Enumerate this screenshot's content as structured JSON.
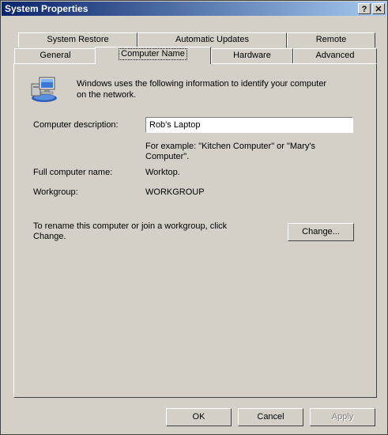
{
  "window": {
    "title": "System Properties",
    "help_label": "?",
    "close_label": "✕"
  },
  "tabs": {
    "row1": [
      "System Restore",
      "Automatic Updates",
      "Remote"
    ],
    "row2": [
      "General",
      "Computer Name",
      "Hardware",
      "Advanced"
    ],
    "active": "Computer Name"
  },
  "content": {
    "intro_text_line1": "Windows uses the following information to identify your computer",
    "intro_text_line2": "on the network.",
    "description_label": "Computer description:",
    "description_value": "Rob's Laptop",
    "example_line1": "For example: \"Kitchen Computer\" or \"Mary's",
    "example_line2": "Computer\".",
    "full_name_label": "Full computer name:",
    "full_name_value": "Worktop.",
    "workgroup_label": "Workgroup:",
    "workgroup_value": "WORKGROUP",
    "rename_line1": "To rename this computer or join a workgroup, click",
    "rename_line2": "Change.",
    "change_button": "Change..."
  },
  "footer": {
    "ok_button": "OK",
    "cancel_button": "Cancel",
    "apply_button": "Apply"
  },
  "icon": "computer-network-icon"
}
